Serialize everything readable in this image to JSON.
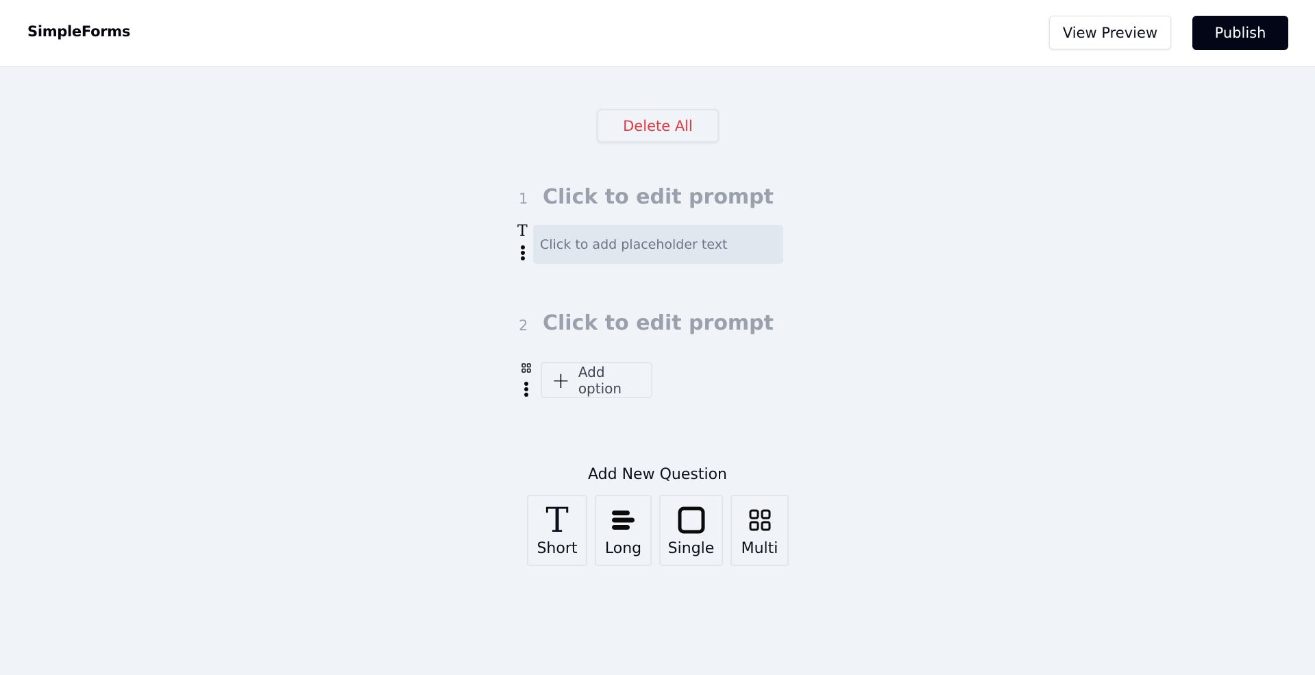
{
  "header": {
    "logo": "SimpleForms",
    "view_preview_label": "View Preview",
    "publish_label": "Publish"
  },
  "toolbar": {
    "delete_all_label": "Delete All"
  },
  "questions": [
    {
      "number": "1",
      "prompt": "Click to edit prompt",
      "type": "short",
      "type_icon": "text-type-icon",
      "placeholder": "Click to add placeholder text"
    },
    {
      "number": "2",
      "prompt": "Click to edit prompt",
      "type": "multi",
      "type_icon": "grid-icon",
      "add_option_label": "Add option"
    }
  ],
  "add_question": {
    "title": "Add New Question",
    "types": [
      {
        "label": "Short",
        "icon": "text-type-icon"
      },
      {
        "label": "Long",
        "icon": "lines-icon"
      },
      {
        "label": "Single",
        "icon": "square-icon"
      },
      {
        "label": "Multi",
        "icon": "grid-icon"
      }
    ]
  },
  "colors": {
    "background": "#f0f3f8",
    "publish_bg": "#030617",
    "delete_text": "#e5393f",
    "prompt_text": "#9aa1ad"
  }
}
